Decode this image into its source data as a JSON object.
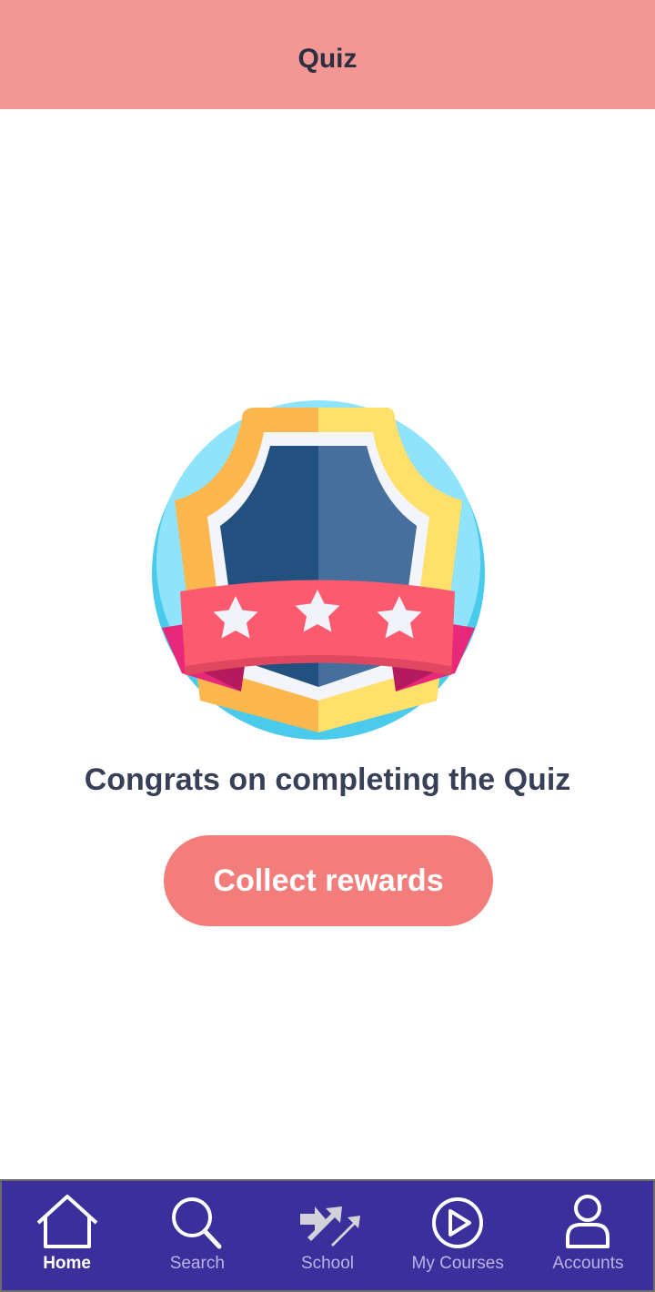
{
  "header": {
    "title": "Quiz"
  },
  "badge": {
    "icon": "shield-badge-icon",
    "stars": 3
  },
  "message": "Congrats on completing the Quiz",
  "actions": {
    "collect_label": "Collect rewards"
  },
  "nav": {
    "items": [
      {
        "label": "Home",
        "icon": "home-icon",
        "active": true
      },
      {
        "label": "Search",
        "icon": "search-icon",
        "active": false
      },
      {
        "label": "School",
        "icon": "school-icon",
        "active": false
      },
      {
        "label": "My Courses",
        "icon": "play-icon",
        "active": false
      },
      {
        "label": "Accounts",
        "icon": "user-icon",
        "active": false
      }
    ]
  },
  "colors": {
    "header_bg": "#f39795",
    "button_bg": "#f27d7b",
    "nav_bg": "#3a2f9b",
    "text_dark": "#384058"
  }
}
